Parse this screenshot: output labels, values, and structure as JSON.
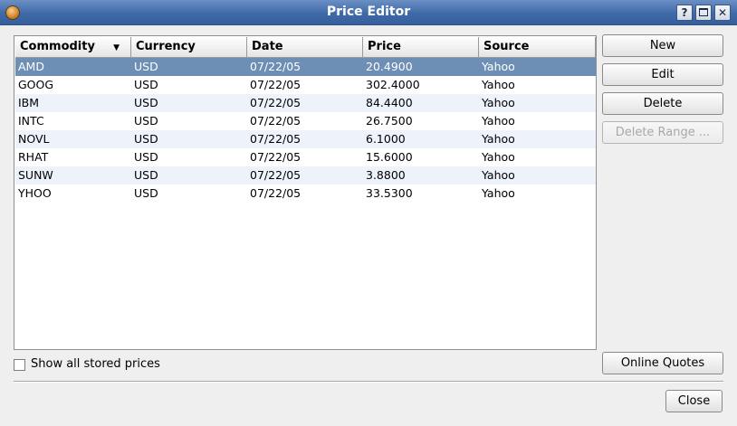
{
  "window": {
    "title": "Price Editor",
    "help_glyph": "?",
    "close_glyph": "✕"
  },
  "table": {
    "columns": [
      "Commodity",
      "Currency",
      "Date",
      "Price",
      "Source"
    ],
    "sort_indicator": "▼",
    "rows": [
      [
        "AMD",
        "USD",
        "07/22/05",
        "20.4900",
        "Yahoo"
      ],
      [
        "GOOG",
        "USD",
        "07/22/05",
        "302.4000",
        "Yahoo"
      ],
      [
        "IBM",
        "USD",
        "07/22/05",
        "84.4400",
        "Yahoo"
      ],
      [
        "INTC",
        "USD",
        "07/22/05",
        "26.7500",
        "Yahoo"
      ],
      [
        "NOVL",
        "USD",
        "07/22/05",
        "6.1000",
        "Yahoo"
      ],
      [
        "RHAT",
        "USD",
        "07/22/05",
        "15.6000",
        "Yahoo"
      ],
      [
        "SUNW",
        "USD",
        "07/22/05",
        "3.8800",
        "Yahoo"
      ],
      [
        "YHOO",
        "USD",
        "07/22/05",
        "33.5300",
        "Yahoo"
      ]
    ]
  },
  "buttons": {
    "new": "New",
    "edit": "Edit",
    "delete": "Delete",
    "delete_range": "Delete Range ...",
    "online_quotes": "Online Quotes",
    "close": "Close"
  },
  "options": {
    "show_all_label": "Show all stored prices"
  },
  "colors": {
    "titlebar": "#3f6aa8",
    "selection": "#6d8fb5",
    "alt_row": "#eef3fb"
  }
}
